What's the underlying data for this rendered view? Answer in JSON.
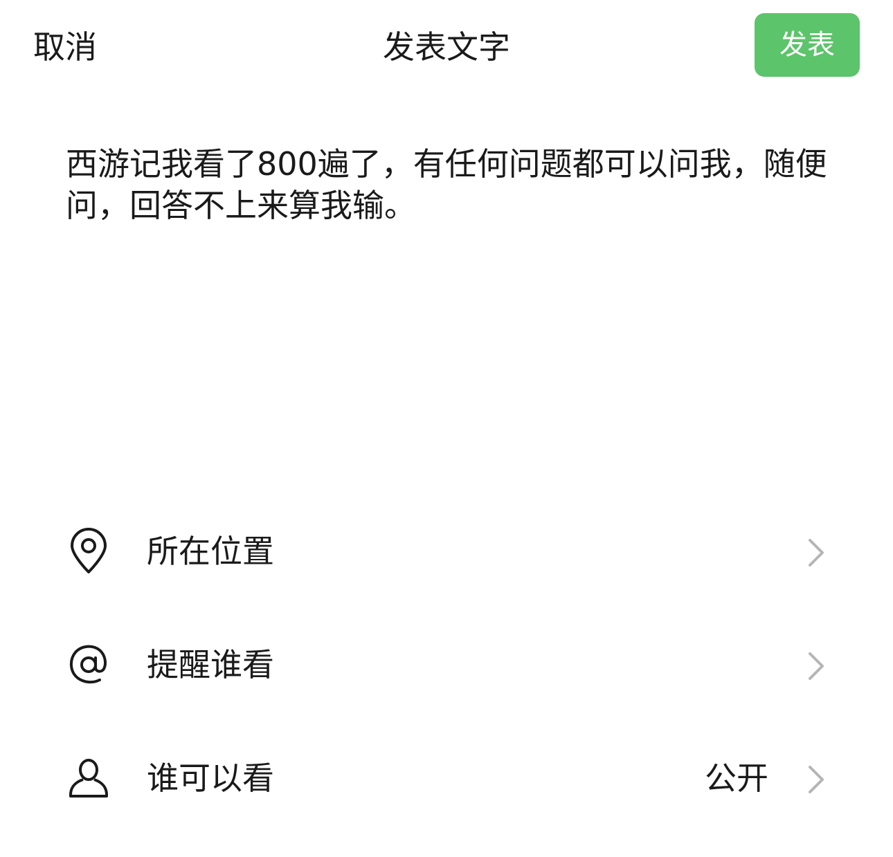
{
  "header": {
    "cancel_label": "取消",
    "title": "发表文字",
    "publish_label": "发表",
    "publish_color": "#5cc46a"
  },
  "post": {
    "text": "西游记我看了800遍了，有任何问题都可以问我，随便问，回答不上来算我输。"
  },
  "options": [
    {
      "icon": "location-pin-icon",
      "label": "所在位置",
      "value": ""
    },
    {
      "icon": "at-sign-icon",
      "label": "提醒谁看",
      "value": ""
    },
    {
      "icon": "person-icon",
      "label": "谁可以看",
      "value": "公开"
    }
  ]
}
